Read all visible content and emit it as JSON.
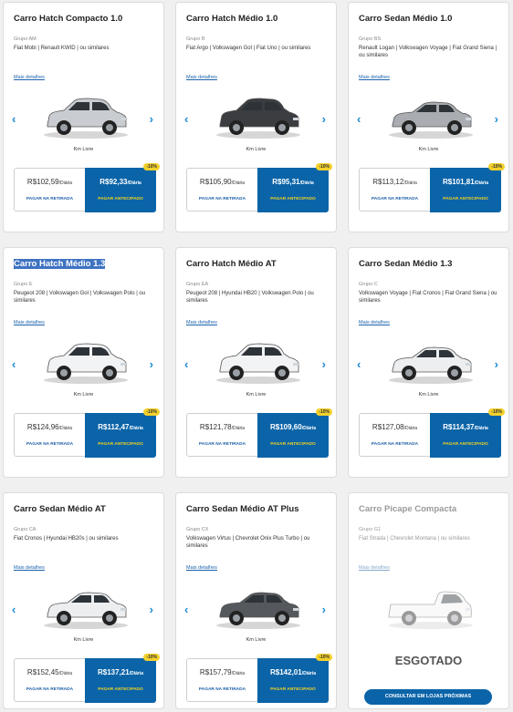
{
  "common": {
    "details_label": "Mais detalhes",
    "km_label": "Km Livre",
    "per_day": "/Diária",
    "pay_later_label": "PAGAR NA RETIRADA",
    "pay_now_label": "PAGAR ANTECIPADO",
    "discount": "-10%",
    "prev_arrow": "‹",
    "next_arrow": "›"
  },
  "cars": [
    {
      "title": "Carro Hatch Compacto 1.0",
      "group": "Grupo AM",
      "models": "Fiat Mobi | Renault KWID | ou similares",
      "price": "R$102,59",
      "price_discount": "R$92,33",
      "car_type": "hatch",
      "color": "#c9ccd0",
      "selected": false,
      "sold_out": false
    },
    {
      "title": "Carro Hatch Médio 1.0",
      "group": "Grupo B",
      "models": "Fiat Argo | Volkswagen Gol | Fiat Uno | ou similares",
      "price": "R$105,90",
      "price_discount": "R$95,31",
      "car_type": "hatch",
      "color": "#3b3d41",
      "selected": false,
      "sold_out": false
    },
    {
      "title": "Carro Sedan Médio 1.0",
      "group": "Grupo BS",
      "models": "Renault Logan | Volkswagen Voyage | Fiat Grand Siena | ou similares",
      "price": "R$113,12",
      "price_discount": "R$101,81",
      "car_type": "sedan",
      "color": "#a9adb2",
      "selected": false,
      "sold_out": false
    },
    {
      "title": "Carro Hatch Médio 1.3",
      "group": "Grupo E",
      "models": "Peugeot 208 | Volkswagen Gol | Volkswagen Polo | ou similares",
      "price": "R$124,96",
      "price_discount": "R$112,47",
      "car_type": "hatch",
      "color": "#f2f3f4",
      "selected": true,
      "sold_out": false
    },
    {
      "title": "Carro Hatch Médio AT",
      "group": "Grupo EA",
      "models": "Peugeot 208 | Hyundai HB20 | Volkswagen Polo | ou similares",
      "price": "R$121,78",
      "price_discount": "R$109,60",
      "car_type": "hatch",
      "color": "#f2f3f4",
      "selected": false,
      "sold_out": false
    },
    {
      "title": "Carro Sedan Médio 1.3",
      "group": "Grupo C",
      "models": "Volkswagen Voyage | Fiat Cronos | Fiat Grand Siena | ou similares",
      "price": "R$127,08",
      "price_discount": "R$114,37",
      "car_type": "sedan",
      "color": "#eceef0",
      "selected": false,
      "sold_out": false
    },
    {
      "title": "Carro Sedan Médio AT",
      "group": "Grupo CA",
      "models": "Fiat Cronos | Hyundai HB20s | ou similares",
      "price": "R$152,45",
      "price_discount": "R$137,21",
      "car_type": "sedan",
      "color": "#eceef0",
      "selected": false,
      "sold_out": false
    },
    {
      "title": "Carro Sedan Médio AT Plus",
      "group": "Grupo CX",
      "models": "Volkswagen Virtus | Chevrolet Onix Plus Turbo | ou similares",
      "price": "R$157,79",
      "price_discount": "R$142,01",
      "car_type": "sedan",
      "color": "#55585d",
      "selected": false,
      "sold_out": false
    },
    {
      "title": "Carro Picape Compacta",
      "group": "Grupo G1",
      "models": "Fiat Strada | Chevrolet Montana | ou similares",
      "car_type": "pickup",
      "color": "#f2f3f4",
      "selected": false,
      "sold_out": true,
      "sold_label": "ESGOTADO",
      "consult_label": "CONSULTAR EM LOJAS PRÓXIMAS"
    }
  ]
}
